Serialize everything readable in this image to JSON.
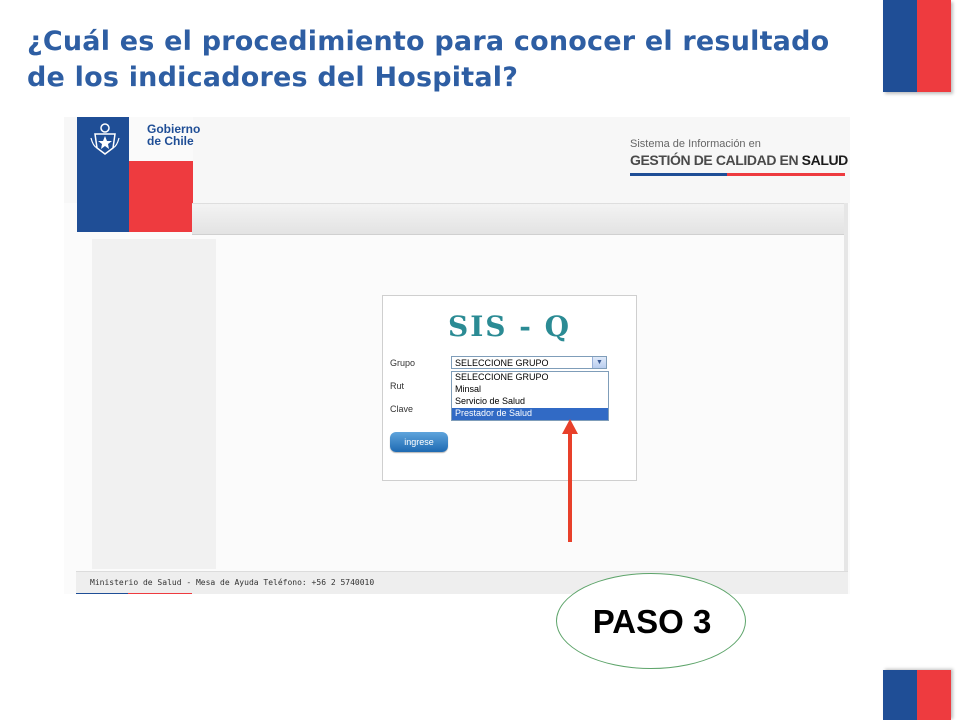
{
  "slide": {
    "title": "¿Cuál es el procedimiento para  conocer el resultado de los indicadores del Hospital?",
    "step_label": "PASO 3"
  },
  "colors": {
    "flag_blue": "#1f4e96",
    "flag_red": "#ee3b3f",
    "title_blue": "#2e5ea3",
    "arrow": "#e8402a",
    "ellipse_border": "#5da46a"
  },
  "screenshot": {
    "logo_text": "Gobierno\nde Chile",
    "brand": {
      "subtitle": "Sistema de Información en",
      "main_prefix": "GESTIÓN DE CALIDAD EN",
      "main_strong": "SALUD"
    },
    "login": {
      "title": "SIS - Q",
      "labels": {
        "group": "Grupo",
        "rut": "Rut",
        "password": "Clave"
      },
      "select_value": "SELECCIONE GRUPO",
      "options": [
        {
          "label": "SELECCIONE GRUPO",
          "selected": false
        },
        {
          "label": "Minsal",
          "selected": false
        },
        {
          "label": "Servicio de Salud",
          "selected": false
        },
        {
          "label": "Prestador de Salud",
          "selected": true
        }
      ],
      "submit_label": "ingrese"
    },
    "footer": "Ministerio de Salud - Mesa de Ayuda Teléfono: +56 2 5740010"
  }
}
